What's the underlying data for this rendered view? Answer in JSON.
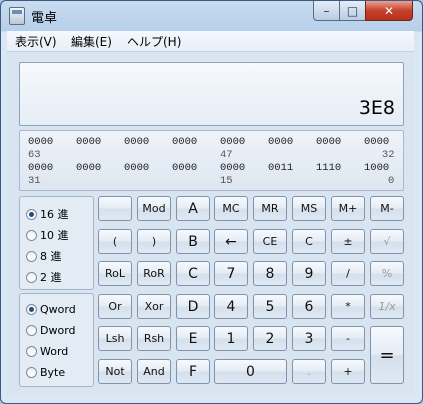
{
  "window": {
    "title": "電卓"
  },
  "menu": [
    "表示(V)",
    "編集(E)",
    "ヘルプ(H)"
  ],
  "display": {
    "value": "3E8"
  },
  "bits": {
    "row1": [
      "0000",
      "0000",
      "0000",
      "0000",
      "0000",
      "0000",
      "0000",
      "0000"
    ],
    "row1_pos": [
      "63",
      "47",
      "32"
    ],
    "row2": [
      "0000",
      "0000",
      "0000",
      "0000",
      "0000",
      "0011",
      "1110",
      "1000"
    ],
    "row2_pos": [
      "31",
      "15",
      "0"
    ]
  },
  "radix": {
    "options": [
      "16 進",
      "10 進",
      "8 進",
      "2 進"
    ],
    "selected": 0
  },
  "wordsize": {
    "options": [
      "Qword",
      "Dword",
      "Word",
      "Byte"
    ],
    "selected": 0
  },
  "buttons": {
    "blank": "",
    "mod": "Mod",
    "a": "A",
    "mc": "MC",
    "mr": "MR",
    "ms": "MS",
    "mplus": "M+",
    "mminus": "M-",
    "lparen": "(",
    "rparen": ")",
    "b": "B",
    "back": "←",
    "ce": "CE",
    "c": "C",
    "plusminus": "±",
    "sqrt": "√",
    "rol": "RoL",
    "ror": "RoR",
    "cc": "C",
    "n7": "7",
    "n8": "8",
    "n9": "9",
    "div": "/",
    "pct": "%",
    "or": "Or",
    "xor": "Xor",
    "d": "D",
    "n4": "4",
    "n5": "5",
    "n6": "6",
    "mul": "*",
    "recip": "1/x",
    "lsh": "Lsh",
    "rsh": "Rsh",
    "e": "E",
    "n1": "1",
    "n2": "2",
    "n3": "3",
    "sub": "-",
    "eq": "=",
    "not": "Not",
    "and": "And",
    "f": "F",
    "n0": "0",
    "dot": ".",
    "add": "+"
  }
}
